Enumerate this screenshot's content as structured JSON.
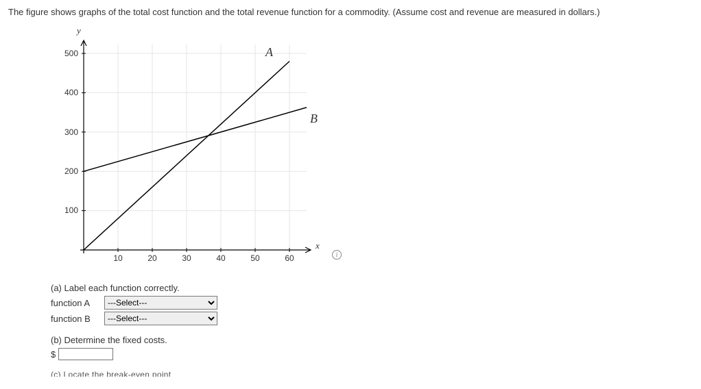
{
  "prompt_text": "The figure shows graphs of the total cost function and the total revenue function for a commodity. (Assume cost and revenue are measured in dollars.)",
  "chart": {
    "y_axis_label": "y",
    "x_axis_label": "x",
    "label_A": "A",
    "label_B": "B"
  },
  "chart_data": {
    "type": "line",
    "title": "",
    "xlabel": "x",
    "ylabel": "y",
    "xlim": [
      0,
      65
    ],
    "ylim": [
      0,
      540
    ],
    "x_ticks": [
      10,
      20,
      30,
      40,
      50,
      60
    ],
    "y_ticks": [
      100,
      200,
      300,
      400,
      500
    ],
    "series": [
      {
        "name": "A",
        "x": [
          0,
          60
        ],
        "y": [
          0,
          480
        ]
      },
      {
        "name": "B",
        "x": [
          0,
          65
        ],
        "y": [
          200,
          362.5
        ]
      }
    ],
    "annotations": [
      {
        "label": "A",
        "x": 56,
        "y": 510
      },
      {
        "label": "B",
        "x": 65,
        "y": 330
      }
    ],
    "intersection_approx": {
      "x": 36.4,
      "y": 291
    }
  },
  "question_a": {
    "title": "(a) Label each function correctly.",
    "fnA_label": "function A",
    "fnB_label": "function B",
    "select_placeholder": "---Select---"
  },
  "question_b": {
    "title": "(b) Determine the fixed costs.",
    "currency": "$"
  },
  "cutoff_text": "(c) Locate the break-even point"
}
